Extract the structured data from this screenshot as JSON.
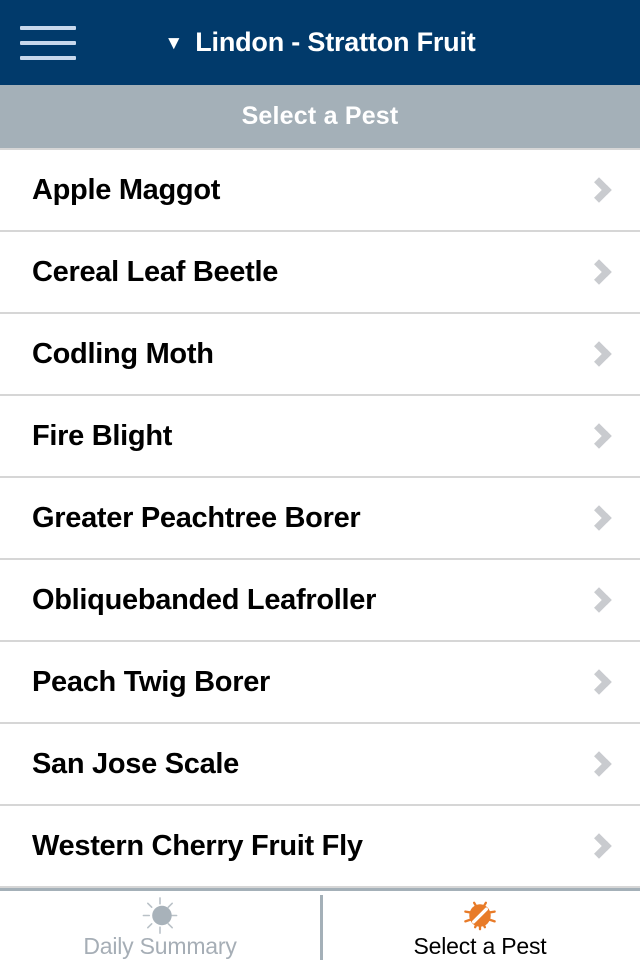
{
  "navbar": {
    "menu_icon": "hamburger-menu-icon",
    "caret": "▼",
    "title": "Lindon - Stratton Fruit",
    "background_color": "#013a6b"
  },
  "subheader": {
    "title": "Select a Pest",
    "background_color": "#a4b0b8",
    "text_color": "#ffffff"
  },
  "list": {
    "accessory_icon": "chevron-right-icon",
    "items": [
      {
        "label": "Apple Maggot"
      },
      {
        "label": "Cereal Leaf Beetle"
      },
      {
        "label": "Codling Moth"
      },
      {
        "label": "Fire Blight"
      },
      {
        "label": "Greater Peachtree Borer"
      },
      {
        "label": "Obliquebanded Leafroller"
      },
      {
        "label": "Peach Twig Borer"
      },
      {
        "label": "San Jose Scale"
      },
      {
        "label": "Western Cherry Fruit Fly"
      }
    ]
  },
  "tabbar": {
    "tabs": [
      {
        "label": "Daily Summary",
        "icon": "sun-icon",
        "active": false,
        "color": "#a6aeb6"
      },
      {
        "label": "Select a Pest",
        "icon": "bug-icon",
        "active": true,
        "color": "#e87b28"
      }
    ]
  }
}
